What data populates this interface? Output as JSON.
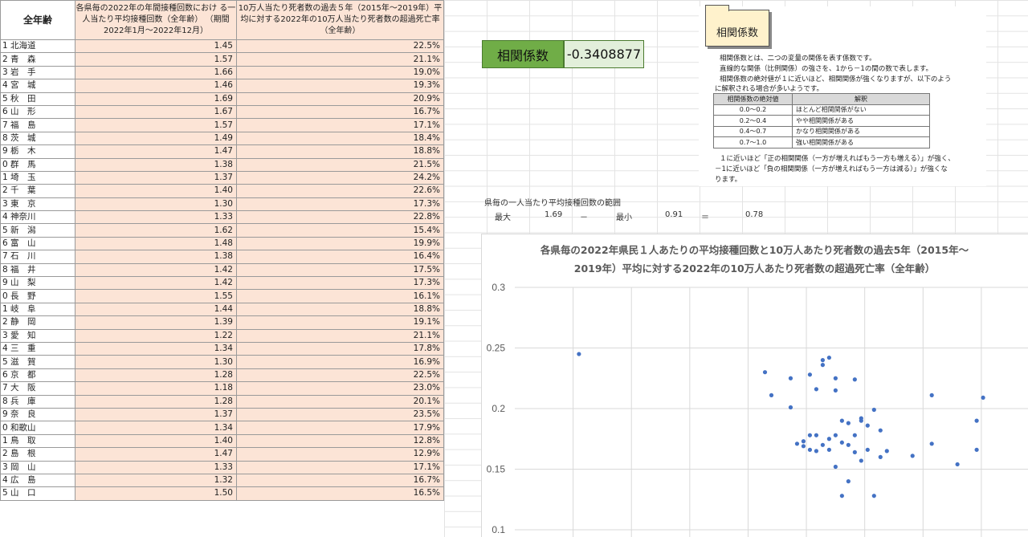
{
  "table": {
    "corner_label": "全年齢",
    "col1_header": "各県毎の2022年の年間接種回数におけ る一人当たり平均接種回数（全年齢） （期間2022年1月～2022年12月）",
    "col2_header": "10万人当たり死者数の過去５年（2015年～2019年）平均に対する2022年の10万人当たり死者数の超過死亡率（全年齢）",
    "rows": [
      {
        "pref": "1 北海道",
        "doses": "1.45",
        "excess": "22.5%"
      },
      {
        "pref": "2 青　森",
        "doses": "1.57",
        "excess": "21.1%"
      },
      {
        "pref": "3 岩　手",
        "doses": "1.66",
        "excess": "19.0%"
      },
      {
        "pref": "4 宮　城",
        "doses": "1.46",
        "excess": "19.3%"
      },
      {
        "pref": "5 秋　田",
        "doses": "1.69",
        "excess": "20.9%"
      },
      {
        "pref": "6 山　形",
        "doses": "1.67",
        "excess": "16.7%"
      },
      {
        "pref": "7 福　島",
        "doses": "1.57",
        "excess": "17.1%"
      },
      {
        "pref": "8 茨　城",
        "doses": "1.49",
        "excess": "18.4%"
      },
      {
        "pref": "9 栃　木",
        "doses": "1.47",
        "excess": "18.8%"
      },
      {
        "pref": "0 群　馬",
        "doses": "1.38",
        "excess": "21.5%"
      },
      {
        "pref": "1 埼　玉",
        "doses": "1.37",
        "excess": "24.2%"
      },
      {
        "pref": "2 千　葉",
        "doses": "1.40",
        "excess": "22.6%"
      },
      {
        "pref": "3 東　京",
        "doses": "1.30",
        "excess": "17.3%"
      },
      {
        "pref": "4 神奈川",
        "doses": "1.33",
        "excess": "22.8%"
      },
      {
        "pref": "5 新　潟",
        "doses": "1.62",
        "excess": "15.4%"
      },
      {
        "pref": "6 富　山",
        "doses": "1.48",
        "excess": "19.9%"
      },
      {
        "pref": "7 石　川",
        "doses": "1.38",
        "excess": "16.4%"
      },
      {
        "pref": "8 福　井",
        "doses": "1.42",
        "excess": "17.5%"
      },
      {
        "pref": "9 山　梨",
        "doses": "1.42",
        "excess": "17.3%"
      },
      {
        "pref": "0 長　野",
        "doses": "1.55",
        "excess": "16.1%"
      },
      {
        "pref": "1 岐　阜",
        "doses": "1.44",
        "excess": "18.8%"
      },
      {
        "pref": "2 静　岡",
        "doses": "1.39",
        "excess": "19.1%"
      },
      {
        "pref": "3 愛　知",
        "doses": "1.22",
        "excess": "21.1%"
      },
      {
        "pref": "4 三　重",
        "doses": "1.34",
        "excess": "17.8%"
      },
      {
        "pref": "5 滋　賀",
        "doses": "1.30",
        "excess": "16.9%"
      },
      {
        "pref": "6 京　都",
        "doses": "1.28",
        "excess": "22.5%"
      },
      {
        "pref": "7 大　阪",
        "doses": "1.18",
        "excess": "23.0%"
      },
      {
        "pref": "8 兵　庫",
        "doses": "1.28",
        "excess": "20.1%"
      },
      {
        "pref": "9 奈　良",
        "doses": "1.37",
        "excess": "23.5%"
      },
      {
        "pref": "0 和歌山",
        "doses": "1.34",
        "excess": "17.9%"
      },
      {
        "pref": "1 鳥　取",
        "doses": "1.40",
        "excess": "12.8%"
      },
      {
        "pref": "2 島　根",
        "doses": "1.47",
        "excess": "12.9%"
      },
      {
        "pref": "3 岡　山",
        "doses": "1.33",
        "excess": "17.1%"
      },
      {
        "pref": "4 広　島",
        "doses": "1.32",
        "excess": "16.7%"
      },
      {
        "pref": "5 山　口",
        "doses": "1.50",
        "excess": "16.5%"
      }
    ]
  },
  "correlation": {
    "label": "相関係数",
    "value": "-0.3408877"
  },
  "note": {
    "title": "相関係数",
    "lines": [
      "相関係数とは、二つの変量の関係を表す係数です。",
      "直線的な関係（比例関係）の強さを、1から－1の間の数で表します。",
      "相関係数の絶対値が１に近いほど、相関関係が強くなりますが、以下のよう",
      "に解釈される場合が多いようです。"
    ],
    "table_headers": [
      "相関係数の絶対値",
      "解釈"
    ],
    "table_rows": [
      {
        "range": "0.0～0.2",
        "meaning": "ほとんど相関関係がない"
      },
      {
        "range": "0.2～0.4",
        "meaning": "やや相関関係がある"
      },
      {
        "range": "0.4～0.7",
        "meaning": "かなり相関関係がある"
      },
      {
        "range": "0.7～1.0",
        "meaning": "強い相関関係がある"
      }
    ],
    "footer_lines": [
      "１に近いほど「正の相関関係（一方が増えればもう一方も増える）」が強く、",
      "－1に近いほど「負の相関関係（一方が増えればもう一方は減る）」が強くな",
      "ります。"
    ]
  },
  "range": {
    "caption": "県毎の一人当たり平均接種回数の範囲",
    "max_label": "最大",
    "max_value": "1.69",
    "minus": "－",
    "min_label": "最小",
    "min_value": "0.91",
    "equals": "＝",
    "diff_value": "0.78"
  },
  "chart_data": {
    "type": "scatter",
    "title_line1": "各県毎の2022年県民１人あたりの平均接種回数と10万人あたり死者数の過去5年（2015年～",
    "title_line2": "2019年）平均に対する2022年の10万人あたり死者数の超過死亡率（全年齢）",
    "y_ticks": [
      "0.3",
      "0.25",
      "0.2",
      "0.15",
      "0.1"
    ],
    "ylim": [
      0.1,
      0.3
    ],
    "xlim": [
      0.9,
      1.7
    ],
    "points": [
      [
        1.0,
        0.245
      ],
      [
        1.29,
        0.23
      ],
      [
        1.33,
        0.225
      ],
      [
        1.3,
        0.211
      ],
      [
        1.36,
        0.228
      ],
      [
        1.39,
        0.242
      ],
      [
        1.38,
        0.236
      ],
      [
        1.37,
        0.216
      ],
      [
        1.4,
        0.215
      ],
      [
        1.43,
        0.224
      ],
      [
        1.4,
        0.225
      ],
      [
        1.38,
        0.24
      ],
      [
        1.33,
        0.201
      ],
      [
        1.41,
        0.19
      ],
      [
        1.42,
        0.188
      ],
      [
        1.44,
        0.19
      ],
      [
        1.45,
        0.186
      ],
      [
        1.46,
        0.199
      ],
      [
        1.47,
        0.182
      ],
      [
        1.44,
        0.192
      ],
      [
        1.42,
        0.17
      ],
      [
        1.41,
        0.172
      ],
      [
        1.43,
        0.178
      ],
      [
        1.45,
        0.166
      ],
      [
        1.4,
        0.178
      ],
      [
        1.39,
        0.166
      ],
      [
        1.43,
        0.164
      ],
      [
        1.36,
        0.178
      ],
      [
        1.35,
        0.173
      ],
      [
        1.34,
        0.171
      ],
      [
        1.35,
        0.169
      ],
      [
        1.36,
        0.166
      ],
      [
        1.37,
        0.178
      ],
      [
        1.38,
        0.17
      ],
      [
        1.37,
        0.165
      ],
      [
        1.4,
        0.152
      ],
      [
        1.42,
        0.14
      ],
      [
        1.41,
        0.128
      ],
      [
        1.46,
        0.128
      ],
      [
        1.48,
        0.165
      ],
      [
        1.52,
        0.161
      ],
      [
        1.55,
        0.171
      ],
      [
        1.55,
        0.211
      ],
      [
        1.59,
        0.154
      ],
      [
        1.62,
        0.19
      ],
      [
        1.63,
        0.209
      ],
      [
        1.62,
        0.166
      ],
      [
        1.47,
        0.16
      ],
      [
        1.44,
        0.157
      ],
      [
        1.39,
        0.175
      ]
    ]
  }
}
